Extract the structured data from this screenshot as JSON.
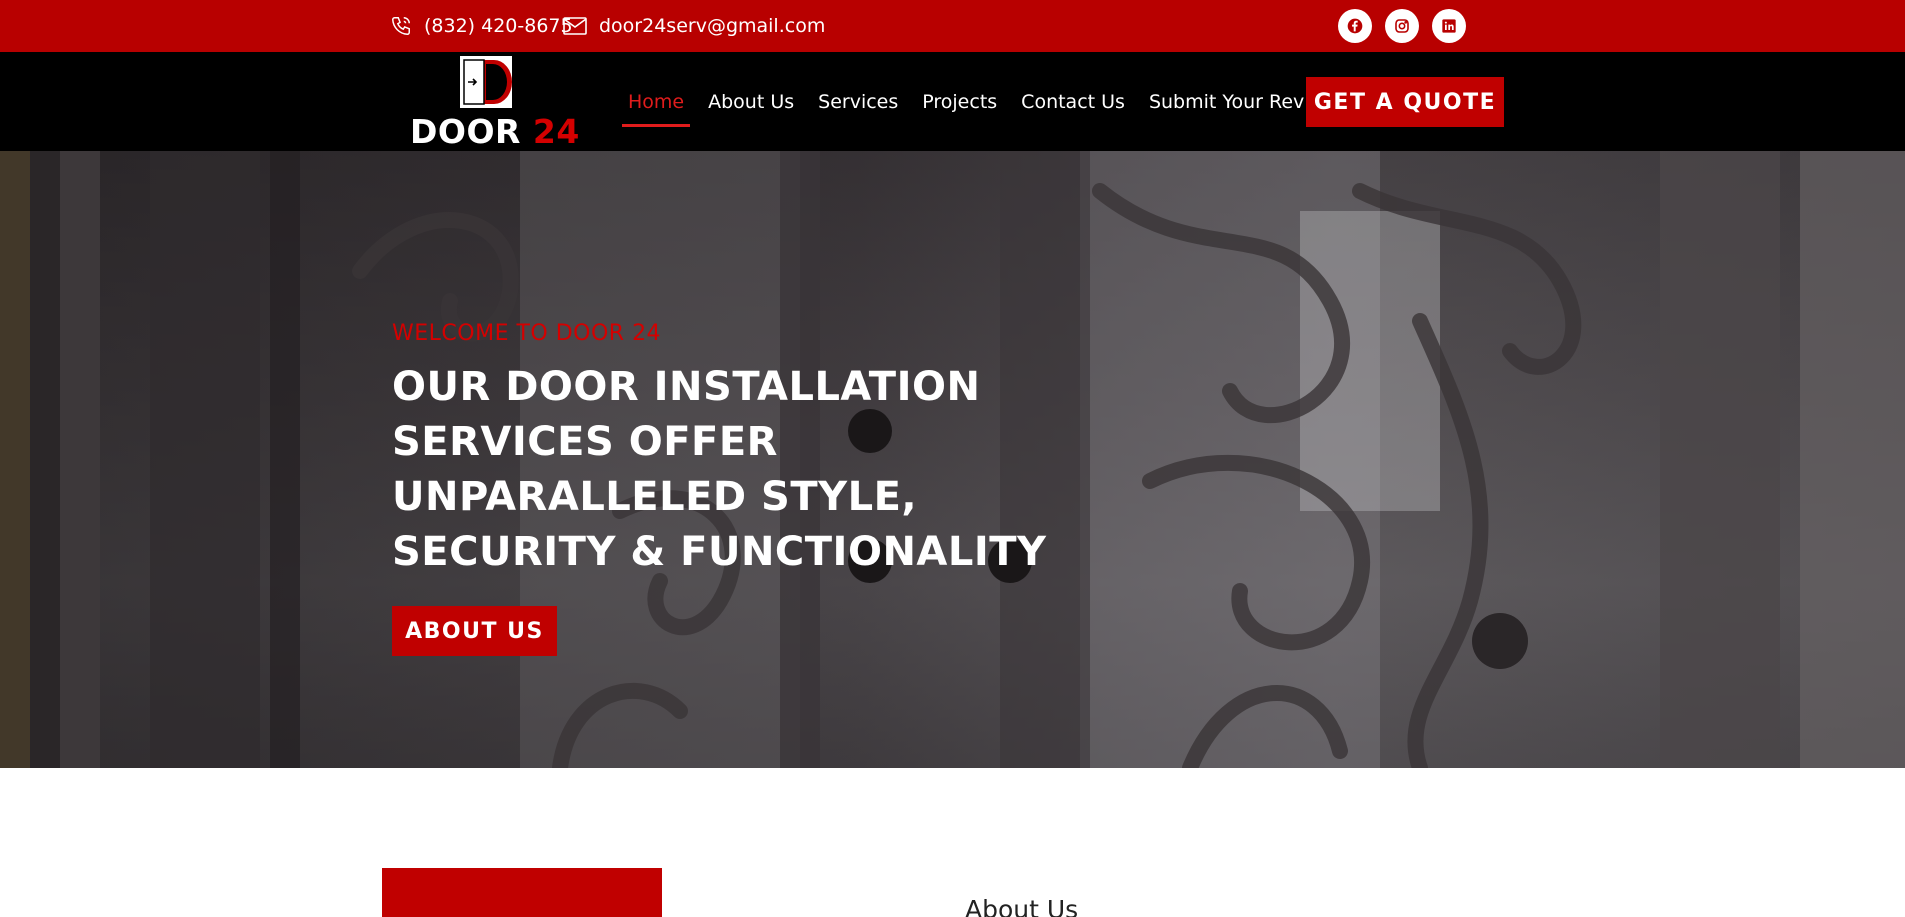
{
  "topbar": {
    "phone": "(832) 420-8675",
    "email": "door24serv@gmail.com",
    "socials": [
      {
        "name": "facebook-icon"
      },
      {
        "name": "instagram-icon"
      },
      {
        "name": "linkedin-icon"
      }
    ]
  },
  "logo": {
    "text_main": "DOOR",
    "text_accent": "24"
  },
  "nav": {
    "items": [
      {
        "label": "Home",
        "active": true
      },
      {
        "label": "About Us"
      },
      {
        "label": "Services"
      },
      {
        "label": "Projects"
      },
      {
        "label": "Contact Us"
      },
      {
        "label": "Submit Your Reviews"
      }
    ],
    "cta": "GET A QUOTE"
  },
  "hero": {
    "kicker": "WELCOME TO DOOR 24",
    "headline": "OUR DOOR INSTALLATION SERVICES OFFER UNPARALLELED STYLE, SECURITY & FUNCTIONALITY",
    "button": "ABOUT US"
  },
  "about": {
    "heading": "About Us"
  },
  "colors": {
    "brand_red": "#b80000",
    "accent_red": "#d40000",
    "black": "#000000",
    "white": "#ffffff"
  }
}
